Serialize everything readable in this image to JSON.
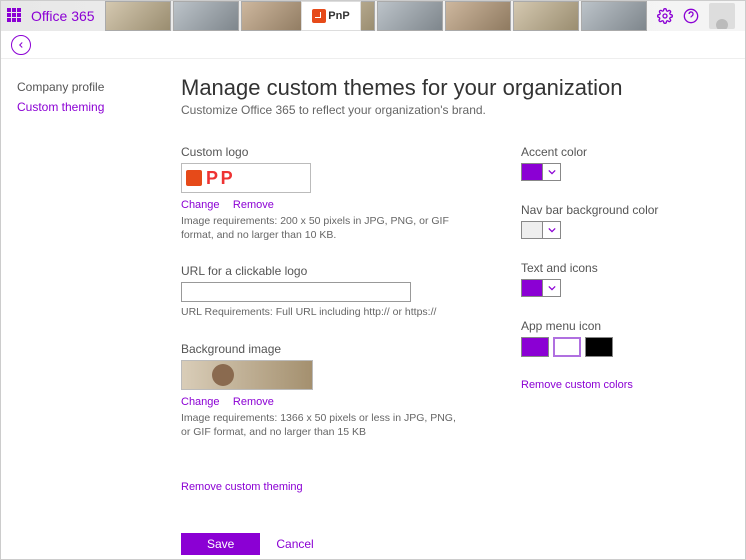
{
  "topbar": {
    "brand": "Office 365",
    "pnp_label": "PnP"
  },
  "sidebar": {
    "items": [
      {
        "label": "Company profile"
      },
      {
        "label": "Custom theming"
      }
    ]
  },
  "page": {
    "title": "Manage custom themes for your organization",
    "subtitle": "Customize Office 365 to reflect your organization's brand."
  },
  "logo": {
    "label": "Custom logo",
    "change": "Change",
    "remove": "Remove",
    "hint": "Image requirements: 200 x 50 pixels in JPG, PNG, or GIF format, and no larger than 10 KB."
  },
  "url": {
    "label": "URL for a clickable logo",
    "value": "",
    "hint": "URL Requirements: Full URL including http:// or https://"
  },
  "bg": {
    "label": "Background image",
    "change": "Change",
    "remove": "Remove",
    "hint": "Image requirements: 1366 x 50 pixels or less in JPG, PNG, or GIF format, and no larger than 15 KB"
  },
  "remove_theming": "Remove custom theming",
  "colors": {
    "accent_label": "Accent color",
    "accent_value": "#8b00d4",
    "nav_label": "Nav bar background color",
    "nav_value": "#eeeeee",
    "text_label": "Text and icons",
    "text_value": "#8b00d4",
    "appmenu_label": "App menu icon",
    "remove_link": "Remove custom colors"
  },
  "buttons": {
    "save": "Save",
    "cancel": "Cancel"
  }
}
